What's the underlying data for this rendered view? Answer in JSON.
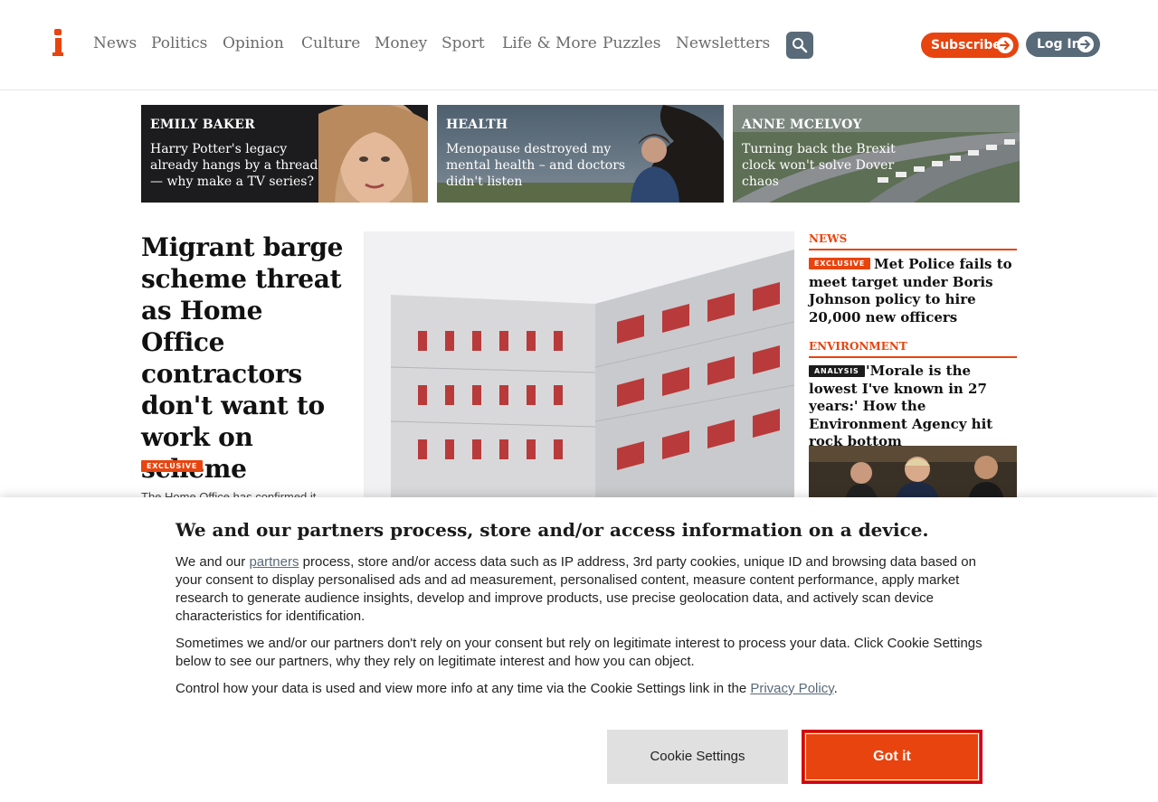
{
  "header": {
    "nav": [
      "News",
      "Politics",
      "Opinion",
      "Culture",
      "Money",
      "Sport",
      "Life & More",
      "Puzzles",
      "Newsletters"
    ],
    "subscribe_label": "Subscribe",
    "login_label": "Log In",
    "brand_color": "#e8440f",
    "secondary_color": "#596a78"
  },
  "promos": [
    {
      "kicker": "EMILY BAKER",
      "title": "Harry Potter's legacy already hangs by a thread — why make a TV series?"
    },
    {
      "kicker": "HEALTH",
      "title": "Menopause destroyed my mental health – and doctors didn't listen"
    },
    {
      "kicker": "ANNE MCELVOY",
      "title": "Turning back the Brexit clock won't solve Dover chaos"
    }
  ],
  "lead": {
    "headline": "Migrant barge scheme threat as Home Office contractors don't want to work on scheme",
    "badge": "EXCLUSIVE",
    "standfirst": "The Home Office has confirmed it"
  },
  "sidebar": {
    "items": [
      {
        "section": "NEWS",
        "badge": "EXCLUSIVE",
        "title": "Met Police fails to meet target under Boris Johnson policy to hire 20,000 new officers"
      },
      {
        "section": "ENVIRONMENT",
        "badge": "ANALYSIS",
        "title": "'Morale is the lowest I've known in 27 years:' How the Environment Agency hit rock bottom"
      }
    ]
  },
  "consent": {
    "heading": "We and our partners process, store and/or access information on a device.",
    "p1_before": "We and our ",
    "p1_link": "partners",
    "p1_after": " process, store and/or access data such as IP address, 3rd party cookies, unique ID and browsing data based on your consent to display personalised ads and ad measurement, personalised content, measure content performance, apply market research to generate audience insights, develop and improve products, use precise geolocation data, and actively scan device characteristics for identification.",
    "p2": "Sometimes we and/or our partners don't rely on your consent but rely on legitimate interest to process your data. Click Cookie Settings below to see our partners, why they rely on legitimate interest and how you can object.",
    "p3_before": "Control how your data is used and view more info at any time via the Cookie Settings link in the ",
    "p3_link": "Privacy Policy",
    "p3_after": ".",
    "settings_label": "Cookie Settings",
    "accept_label": "Got it"
  }
}
